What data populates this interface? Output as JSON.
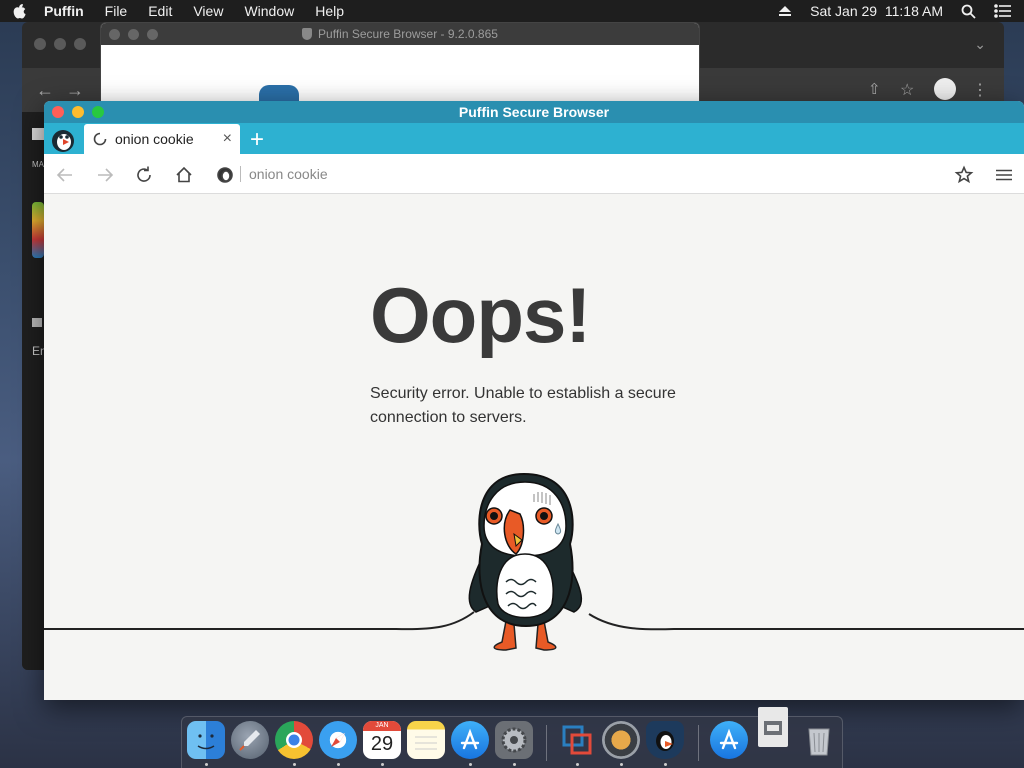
{
  "menubar": {
    "app_name": "Puffin",
    "items": [
      "File",
      "Edit",
      "View",
      "Window",
      "Help"
    ],
    "datetime": "Sat Jan 29  11:18 AM"
  },
  "background_window": {
    "title": "Puffin Secure Browser - 9.2.0.865",
    "sidebar_text_1": "MA",
    "sidebar_text_2": "En"
  },
  "window": {
    "title": "Puffin Secure Browser"
  },
  "tab": {
    "label": "onion cookie"
  },
  "address_bar": {
    "value": "onion cookie"
  },
  "error_page": {
    "heading": "Oops!",
    "message": "Security error. Unable to establish a secure connection to servers."
  },
  "dock": {
    "calendar_month": "JAN",
    "calendar_day": "29",
    "apps": [
      "Finder",
      "Launchpad",
      "Chrome",
      "Safari",
      "Calendar",
      "Notes",
      "App Store",
      "System Preferences",
      "Parallels",
      "Screen Recorder",
      "Puffin",
      "App Store Downloads",
      "Documents",
      "Trash"
    ]
  },
  "colors": {
    "tab_bar": "#2db1d1",
    "title_bar": "#2a8fb0",
    "page_bg": "#f5f5f3",
    "heading": "#3a3a3a"
  }
}
